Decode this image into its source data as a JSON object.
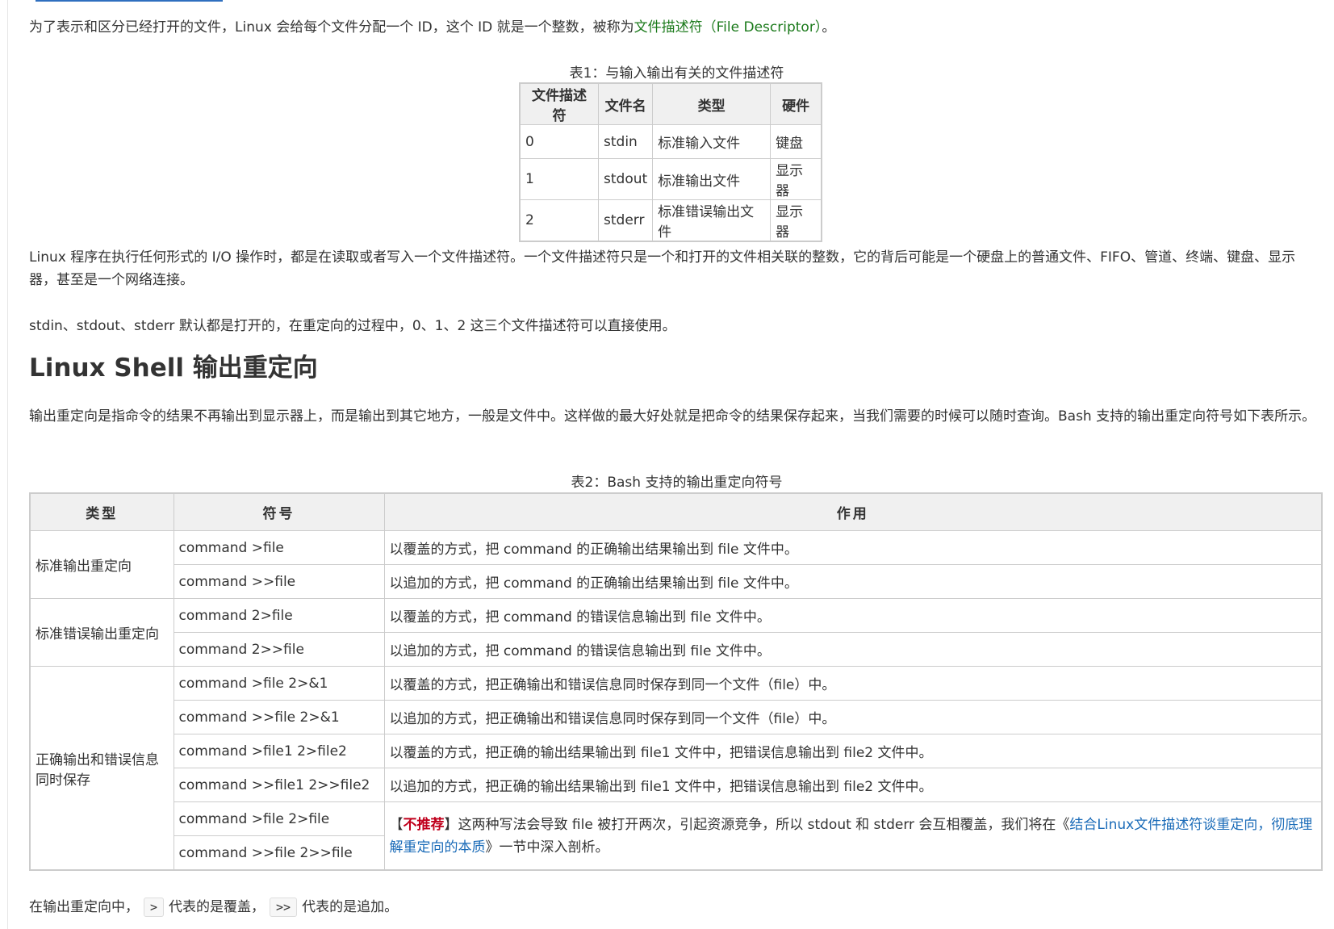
{
  "intro": {
    "text_before": "为了表示和区分已经打开的文件，Linux 会给每个文件分配一个 ID，这个 ID 就是一个整数，被称为",
    "term": "文件描述符（File Descriptor）",
    "text_after": "。"
  },
  "table1": {
    "caption": "表1：与输入输出有关的文件描述符",
    "headers": [
      "文件描述符",
      "文件名",
      "类型",
      "硬件"
    ],
    "rows": [
      [
        "0",
        "stdin",
        "标准输入文件",
        "键盘"
      ],
      [
        "1",
        "stdout",
        "标准输出文件",
        "显示器"
      ],
      [
        "2",
        "stderr",
        "标准错误输出文件",
        "显示器"
      ]
    ]
  },
  "para_io": "Linux 程序在执行任何形式的 I/O 操作时，都是在读取或者写入一个文件描述符。一个文件描述符只是一个和打开的文件相关联的整数，它的背后可能是一个硬盘上的普通文件、FIFO、管道、终端、键盘、显示器，甚至是一个网络连接。",
  "para_default": "stdin、stdout、stderr 默认都是打开的，在重定向的过程中，0、1、2 这三个文件描述符可以直接使用。",
  "heading": "Linux Shell 输出重定向",
  "para_redirect": "输出重定向是指命令的结果不再输出到显示器上，而是输出到其它地方，一般是文件中。这样做的最大好处就是把命令的结果保存起来，当我们需要的时候可以随时查询。Bash 支持的输出重定向符号如下表所示。",
  "table2": {
    "caption": "表2：Bash 支持的输出重定向符号",
    "headers": [
      "类型",
      "符号",
      "作用"
    ],
    "groups": [
      {
        "type": "标准输出重定向",
        "rows": [
          [
            "command >file",
            "以覆盖的方式，把 command 的正确输出结果输出到 file 文件中。"
          ],
          [
            "command >>file",
            "以追加的方式，把 command 的正确输出结果输出到 file 文件中。"
          ]
        ]
      },
      {
        "type": "标准错误输出重定向",
        "rows": [
          [
            "command 2>file",
            "以覆盖的方式，把 command 的错误信息输出到 file 文件中。"
          ],
          [
            "command 2>>file",
            "以追加的方式，把 command 的错误信息输出到 file 文件中。"
          ]
        ]
      },
      {
        "type": "正确输出和错误信息同时保存",
        "rows": [
          [
            "command >file 2>&1",
            "以覆盖的方式，把正确输出和错误信息同时保存到同一个文件（file）中。"
          ],
          [
            "command >>file 2>&1",
            "以追加的方式，把正确输出和错误信息同时保存到同一个文件（file）中。"
          ],
          [
            "command >file1 2>file2",
            "以覆盖的方式，把正确的输出结果输出到 file1 文件中，把错误信息输出到 file2 文件中。"
          ],
          [
            "command >>file1  2>>file2",
            "以追加的方式，把正确的输出结果输出到 file1 文件中，把错误信息输出到 file2 文件中。"
          ],
          [
            "command >file 2>file",
            ""
          ],
          [
            "command >>file 2>>file",
            ""
          ]
        ],
        "note": {
          "bracket_open": "【",
          "tag": "不推荐",
          "bracket_close": "】",
          "text": "这两种写法会导致 file 被打开两次，引起资源竞争，所以 stdout 和 stderr 会互相覆盖，我们将在",
          "link_open": "《",
          "link": "结合Linux文件描述符谈重定向，彻底理解重定向的本质",
          "link_close": "》",
          "text_after": "一节中深入剖析。"
        }
      }
    ]
  },
  "closing": {
    "text1": "在输出重定向中，",
    "code1": ">",
    "text2": "代表的是覆盖，",
    "code2": ">>",
    "text3": "代表的是追加。"
  }
}
